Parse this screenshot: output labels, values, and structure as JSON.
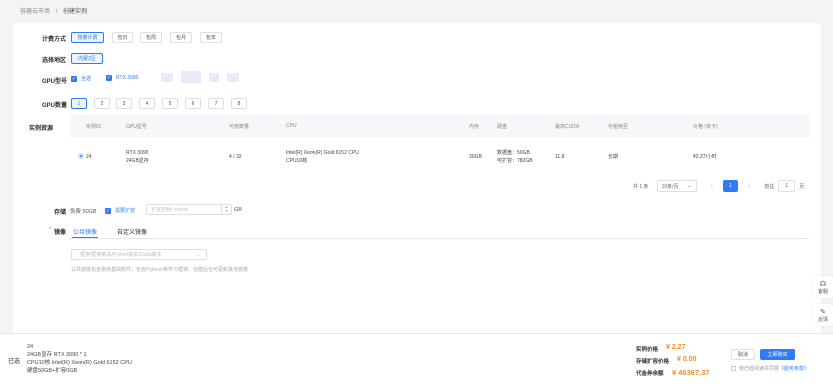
{
  "breadcrumb": {
    "parent": "容器云市场",
    "separator": "/",
    "current": "创建实例"
  },
  "billing": {
    "label": "计费方式",
    "options": [
      "按量计费",
      "包日",
      "包周",
      "包月",
      "包年"
    ],
    "selected": "按量计费"
  },
  "region": {
    "label": "选择地区",
    "options": [
      "内蒙2区"
    ],
    "selected": "内蒙2区"
  },
  "gpu_model": {
    "label": "GPU型号",
    "options": [
      "全选",
      "RTX 3090"
    ]
  },
  "gpu_count": {
    "label": "GPU数量",
    "options": [
      "1",
      "2",
      "3",
      "4",
      "5",
      "6",
      "7",
      "8"
    ],
    "selected": "1"
  },
  "resources": {
    "label": "实例资源",
    "columns": [
      "实例ID",
      "GPU型号",
      "可用数量",
      "CPU",
      "内存",
      "硬盘",
      "最高CUDA",
      "可租用至",
      "价格 (单卡)"
    ],
    "rows": [
      {
        "id": "24",
        "gpu_line1": "RTX 3090",
        "gpu_line2": "24GB显存",
        "available": "4 / 32",
        "cpu_line1": "Intel(R) Xeon(R) Gold 6152 CPU",
        "cpu_line2": "CPU10核",
        "memory": "30GB",
        "disk_line1": "数据盘：50GB",
        "disk_line2": "可扩容：782GB",
        "cuda": "11.8",
        "rent_until": "长期",
        "price": "¥2.27/小时"
      }
    ]
  },
  "pagination": {
    "total": "共 1 条",
    "page_size": "10条/页",
    "page_size_arrow": "⌄",
    "prev": "‹",
    "current": "1",
    "next": "›",
    "goto_label": "前往",
    "goto_value": "1",
    "page_unit": "页"
  },
  "storage": {
    "label": "存储",
    "free": "免费 50GB",
    "expand_label": "需要扩容",
    "expand_placeholder": "扩容范围0-782GB",
    "unit": "GB"
  },
  "image": {
    "required_mark": "*",
    "label": "镜像",
    "tabs": [
      "公共镜像",
      "自定义镜像"
    ],
    "active_tab": "公共镜像",
    "select_placeholder": "框架/框架版本/Python版本/Cuda版本",
    "hint": "公共镜像包含常用基础软件，包含Pytorch等学习框架，创建后也可更新其他镜像"
  },
  "side_tools": [
    {
      "icon": "headset-icon",
      "glyph": "☊",
      "label": "客服"
    },
    {
      "icon": "edit-icon",
      "glyph": "✎",
      "label": "反馈"
    }
  ],
  "footer": {
    "selected_label": "已选",
    "summary": [
      "24",
      "24GB显存 RTX 3090 * 1",
      "CPU10核 Intel(R) Xeon(R) Gold 6152 CPU",
      "硬盘50GB+扩容0GB"
    ],
    "instance_price_label": "实例价格",
    "instance_price": "¥ 2.27",
    "storage_price_label": "存储扩容价格",
    "storage_price": "¥ 0.00",
    "balance_label": "代金券余额",
    "balance": "¥ 46367.37",
    "cancel": "取消",
    "create": "立即购买",
    "agree_text": "我已经阅读并同意",
    "agree_link": "《服务条款》"
  },
  "colors": {
    "primary": "#2f7bf5",
    "price": "#f08c2e",
    "background": "#f3f4f6"
  }
}
